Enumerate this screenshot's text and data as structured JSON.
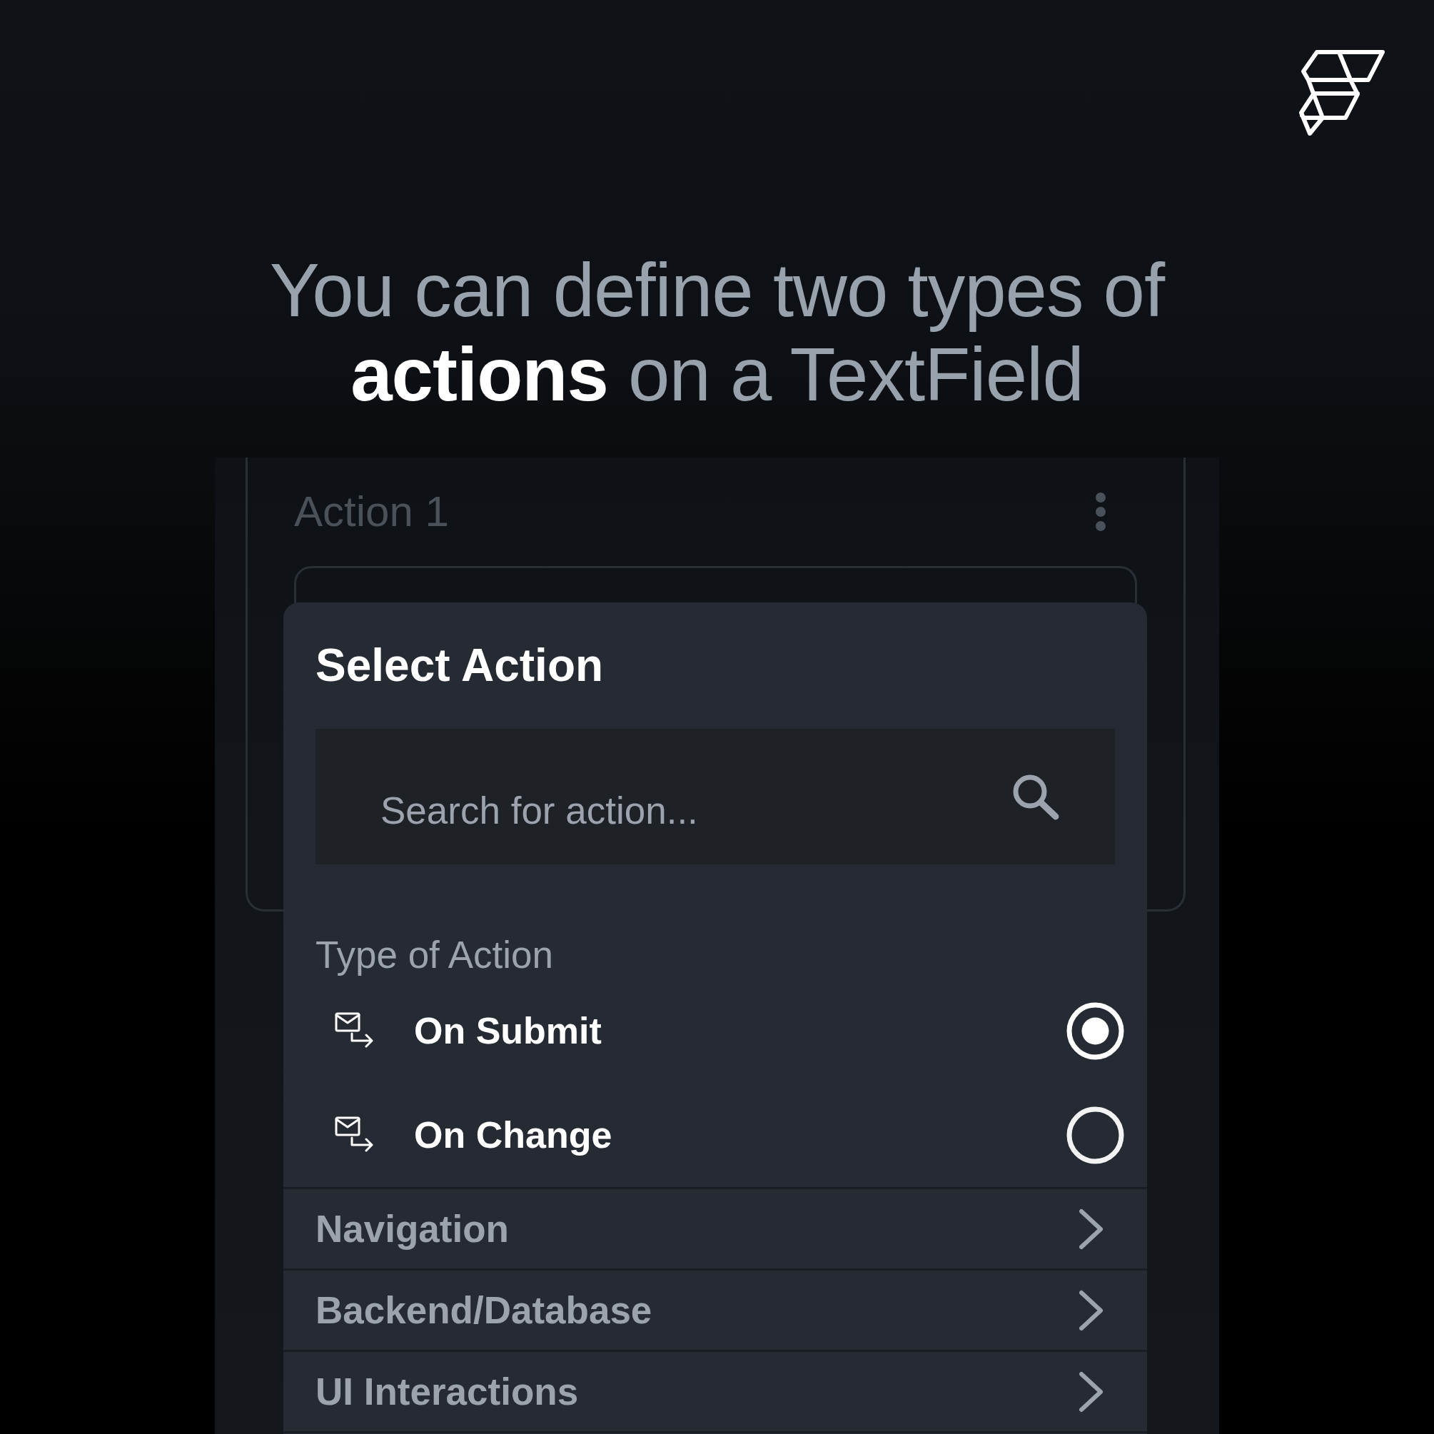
{
  "headline": "You can define two types of **actions** on a TextField",
  "action_card": {
    "title": "Action 1"
  },
  "select_action": {
    "title": "Select Action",
    "search": {
      "placeholder": "Search for action..."
    },
    "type_label": "Type of Action",
    "options": [
      {
        "label": "On Submit",
        "selected": true
      },
      {
        "label": "On Change",
        "selected": false
      }
    ],
    "categories": [
      "Navigation",
      "Backend/Database",
      "UI Interactions"
    ]
  }
}
